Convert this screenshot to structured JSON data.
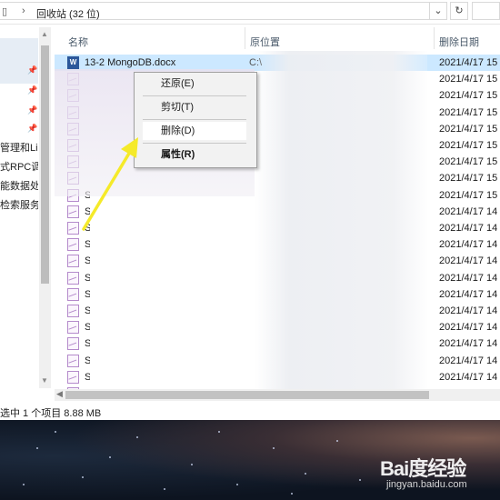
{
  "window": {
    "breadcrumb": "回收站 (32 位)",
    "chevron": "›"
  },
  "columns": {
    "name": "名称",
    "original_location": "原位置",
    "deleted_date": "删除日期"
  },
  "nav": {
    "items": [
      "管理和Lin",
      "式RPC调F",
      "能数据处理",
      "检索服务"
    ]
  },
  "files": [
    {
      "name": "13-2 MongoDB.docx",
      "type": "word",
      "orig": "C:\\",
      "date": "2021/4/17 15",
      "selected": true
    },
    {
      "name": "",
      "type": "img",
      "orig": "",
      "date": "2021/4/17 15"
    },
    {
      "name": "",
      "type": "img",
      "orig": "",
      "date": "2021/4/17 15"
    },
    {
      "name": "",
      "type": "img",
      "orig": "",
      "date": "2021/4/17 15"
    },
    {
      "name": "",
      "type": "img",
      "orig": "",
      "date": "2021/4/17 15"
    },
    {
      "name": "",
      "type": "img",
      "orig": "",
      "date": "2021/4/17 15"
    },
    {
      "name": "",
      "type": "img",
      "orig": "",
      "date": "2021/4/17 15"
    },
    {
      "name": "",
      "type": "img",
      "orig": "",
      "date": "2021/4/17 15"
    },
    {
      "name": "S",
      "type": "img",
      "orig": "",
      "date": "2021/4/17 15"
    },
    {
      "name": "S",
      "type": "img",
      "orig": "",
      "date": "2021/4/17 14"
    },
    {
      "name": "S",
      "type": "img",
      "orig": "",
      "date": "2021/4/17 14"
    },
    {
      "name": "S",
      "type": "img",
      "orig": "",
      "date": "2021/4/17 14"
    },
    {
      "name": "S",
      "type": "img",
      "orig": "",
      "date": "2021/4/17 14"
    },
    {
      "name": "S",
      "type": "img",
      "orig": "",
      "date": "2021/4/17 14"
    },
    {
      "name": "S",
      "type": "img",
      "orig": "",
      "date": "2021/4/17 14"
    },
    {
      "name": "S",
      "type": "img",
      "orig": "",
      "date": "2021/4/17 14"
    },
    {
      "name": "S",
      "type": "img",
      "orig": "",
      "date": "2021/4/17 14"
    },
    {
      "name": "S",
      "type": "img",
      "orig": "",
      "date": "2021/4/17 14"
    },
    {
      "name": "S",
      "type": "img",
      "orig": "",
      "date": "2021/4/17 14"
    },
    {
      "name": "S",
      "type": "img",
      "orig": "",
      "date": "2021/4/17 14"
    },
    {
      "name": "S",
      "type": "img",
      "orig": "",
      "date": "2021/4/17 14"
    }
  ],
  "context_menu": {
    "items": [
      {
        "label": "还原(E)",
        "highlighted": false,
        "bold": false
      },
      {
        "label": "剪切(T)",
        "highlighted": false,
        "bold": false
      },
      {
        "label": "删除(D)",
        "highlighted": true,
        "bold": false
      },
      {
        "label": "属性(R)",
        "highlighted": false,
        "bold": true
      }
    ]
  },
  "status": {
    "text": "选中 1 个项目  8.88 MB"
  },
  "watermark": {
    "logo": "Bai度经验",
    "url": "jingyan.baidu.com"
  },
  "colors": {
    "selection": "#cce8ff",
    "arrow": "#f5ea2a",
    "word_icon": "#2b579a"
  }
}
